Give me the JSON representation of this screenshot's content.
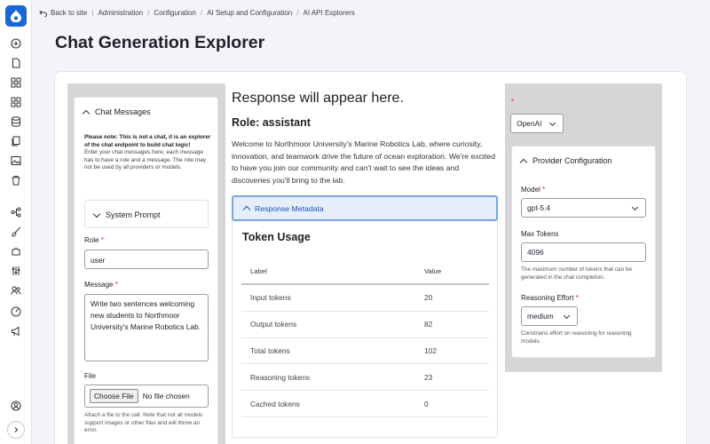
{
  "breadcrumb": {
    "back_label": "Back to site",
    "items": [
      "Administration",
      "Configuration",
      "AI Setup and Configuration",
      "AI API Explorers"
    ]
  },
  "page_title": "Chat Generation Explorer",
  "chat_messages": {
    "header": "Chat Messages",
    "note_bold": "Please note: This is not a chat, it is an explorer of the chat endpoint to build chat logic!",
    "note_text": "Enter your chat messages here, each message has to have a role and a message. The role may not be used by all providers or models.",
    "system_prompt_label": "System Prompt",
    "role_label": "Role",
    "role_value": "user",
    "message_label": "Message",
    "message_value": "Write two sentences welcoming new students to Northmoor University's Marine Robotics Lab.",
    "file_label": "File",
    "file_button": "Choose File",
    "file_status": "No file chosen",
    "file_help": "Attach a file to the call. Note that not all models support images or other files and will throw an error."
  },
  "response": {
    "placeholder": "Response will appear here.",
    "role_heading": "Role: assistant",
    "text": "Welcome to Northmoor University's Marine Robotics Lab, where curiosity, innovation, and teamwork drive the future of ocean exploration. We're excited to have you join our community and can't wait to see the ideas and discoveries you'll bring to the lab.",
    "metadata_label": "Response Metadata",
    "token_usage_title": "Token Usage",
    "table": {
      "headers": [
        "Label",
        "Value"
      ],
      "rows": [
        [
          "Input tokens",
          "20"
        ],
        [
          "Output tokens",
          "82"
        ],
        [
          "Total tokens",
          "102"
        ],
        [
          "Reasoning tokens",
          "23"
        ],
        [
          "Cached tokens",
          "0"
        ]
      ]
    }
  },
  "provider": {
    "selected": "OpenAI",
    "config_header": "Provider Configuration",
    "model_label": "Model",
    "model_value": "gpt-5.4",
    "max_tokens_label": "Max Tokens",
    "max_tokens_value": "4096",
    "max_tokens_help": "The maximum number of tokens that can be generated in the chat completion.",
    "reasoning_label": "Reasoning Effort",
    "reasoning_value": "medium",
    "reasoning_help": "Constrains effort on reasoning for reasoning models."
  },
  "icons": {
    "logo": "drupal-drop-icon",
    "sidebar": [
      "add-icon",
      "document-icon",
      "grid-icon",
      "grid-icon",
      "database-icon",
      "files-icon",
      "media-icon",
      "trash-icon",
      "workflow-icon",
      "brush-icon",
      "puzzle-icon",
      "sliders-icon",
      "people-icon",
      "gauge-icon",
      "megaphone-icon",
      "user-icon",
      "chevron-right-icon"
    ]
  },
  "colors": {
    "accent": "#1a66d6",
    "metadata_bg": "#e6eef9",
    "metadata_border": "#77a6e4",
    "required": "#d72222"
  }
}
